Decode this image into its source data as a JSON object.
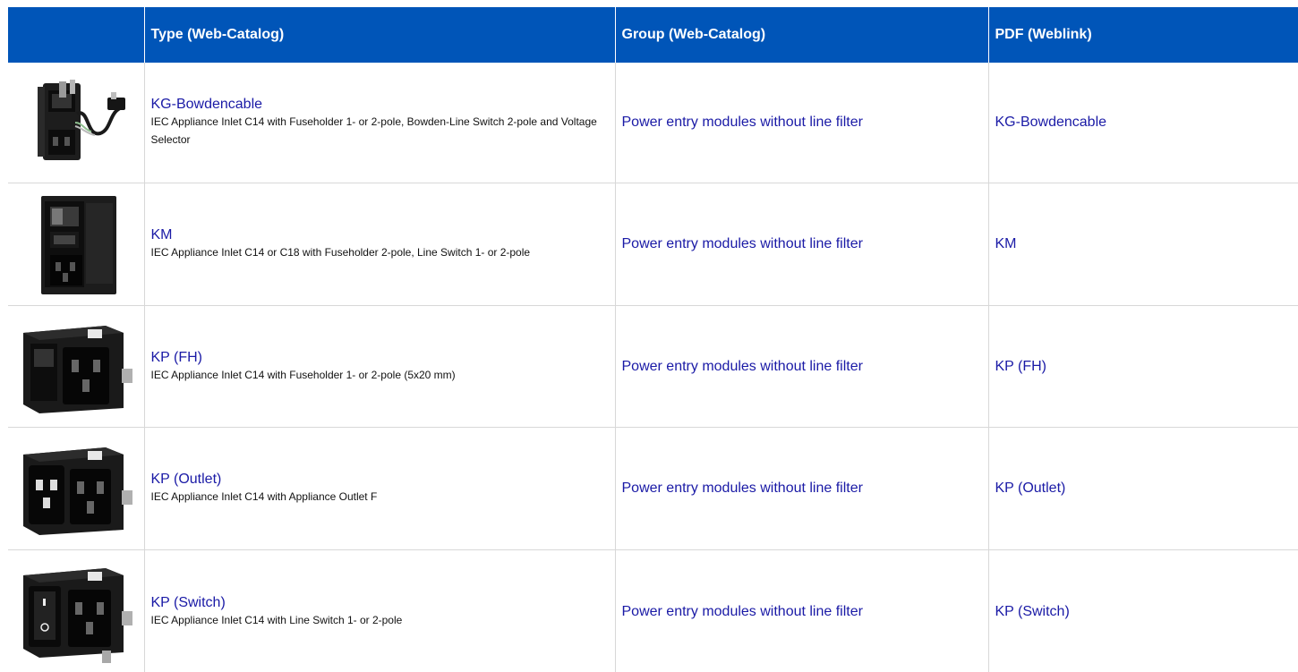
{
  "table": {
    "headers": {
      "image": "",
      "type": "Type (Web-Catalog)",
      "group": "Group (Web-Catalog)",
      "pdf": "PDF (Weblink)"
    },
    "rows": [
      {
        "image_icon": "power-entry-module-bowden-cable-image",
        "type_name": "KG-Bowdencable",
        "type_desc": "IEC Appliance Inlet C14 with Fuseholder 1- or 2-pole, Bowden-Line Switch 2-pole and Voltage Selector",
        "group": "Power entry modules without line filter",
        "pdf": "KG-Bowdencable"
      },
      {
        "image_icon": "power-entry-module-km-image",
        "type_name": "KM",
        "type_desc": "IEC Appliance Inlet C14 or C18 with Fuseholder 2-pole, Line Switch 1- or 2-pole",
        "group": "Power entry modules without line filter",
        "pdf": "KM"
      },
      {
        "image_icon": "power-entry-module-kp-fh-image",
        "type_name": "KP (FH)",
        "type_desc": "IEC Appliance Inlet C14 with Fuseholder 1- or 2-pole (5x20 mm)",
        "group": "Power entry modules without line filter",
        "pdf": "KP (FH)"
      },
      {
        "image_icon": "power-entry-module-kp-outlet-image",
        "type_name": "KP (Outlet)",
        "type_desc": "IEC Appliance Inlet C14 with Appliance Outlet F",
        "group": "Power entry modules without line filter",
        "pdf": "KP (Outlet)"
      },
      {
        "image_icon": "power-entry-module-kp-switch-image",
        "type_name": "KP (Switch)",
        "type_desc": "IEC Appliance Inlet C14 with Line Switch 1- or 2-pole",
        "group": "Power entry modules without line filter",
        "pdf": "KP (Switch)"
      }
    ]
  },
  "colors": {
    "header_bg": "#0055b8",
    "header_text": "#ffffff",
    "link": "#1a1aa6",
    "grid": "#d8d8d8"
  }
}
